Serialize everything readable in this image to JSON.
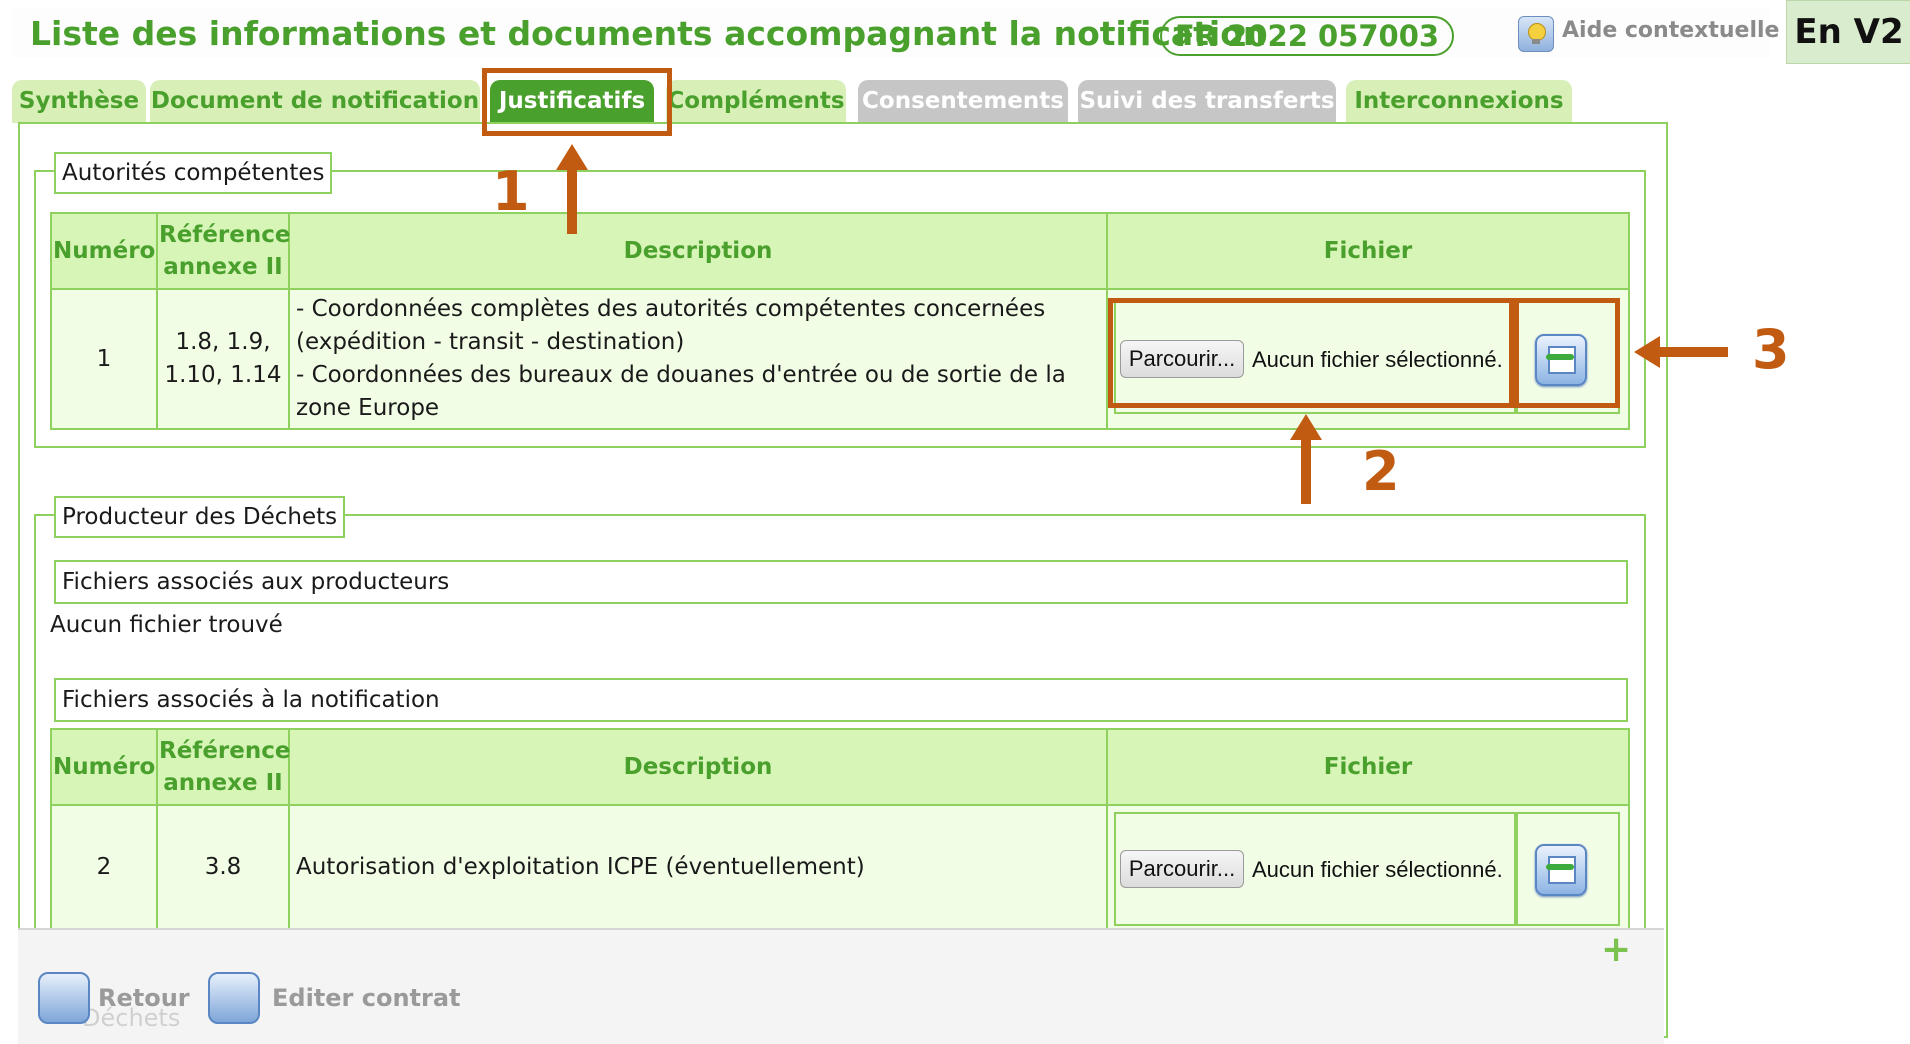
{
  "header": {
    "title": "Liste des informations et documents accompagnant la notification",
    "notification_number": "FR 2022 057003",
    "help_label": "Aide contextuelle",
    "version_tag": "En V2"
  },
  "tabs": [
    {
      "label": "Synthèse",
      "state": "enabled"
    },
    {
      "label": "Document de notification",
      "state": "enabled"
    },
    {
      "label": "Justificatifs",
      "state": "active"
    },
    {
      "label": "Compléments",
      "state": "enabled"
    },
    {
      "label": "Consentements",
      "state": "disabled"
    },
    {
      "label": "Suivi des transferts",
      "state": "disabled"
    },
    {
      "label": "Interconnexions",
      "state": "enabled"
    }
  ],
  "columns": {
    "numero": "Numéro",
    "reference_line1": "Référence",
    "reference_line2": "annexe II",
    "description": "Description",
    "fichier": "Fichier"
  },
  "autorites": {
    "legend": "Autorités compétentes",
    "row": {
      "numero": "1",
      "ref_line1": "1.8, 1.9,",
      "ref_line2": "1.10, 1.14",
      "desc_line1": "- Coordonnées complètes des autorités compétentes concernées",
      "desc_line2": "(expédition - transit - destination)",
      "desc_line3": "- Coordonnées des bureaux de douanes d'entrée ou de sortie de la",
      "desc_line4": "zone Europe",
      "browse_label": "Parcourir...",
      "file_status": "Aucun fichier sélectionné."
    }
  },
  "producteur": {
    "legend": "Producteur des Déchets",
    "producers_files_label": "Fichiers associés aux producteurs",
    "no_file_found": "Aucun fichier trouvé",
    "notification_files_label": "Fichiers associés à la notification",
    "row": {
      "numero": "2",
      "ref": "3.8",
      "description": "Autorisation d'exploitation ICPE (éventuellement)",
      "browse_label": "Parcourir...",
      "file_status": "Aucun fichier sélectionné."
    }
  },
  "footer": {
    "back_label": "Retour",
    "edit_label": "Editer contrat",
    "hidden_text": "Déchets"
  },
  "annotations": [
    "1",
    "2",
    "3"
  ],
  "colors": {
    "brand_green": "#4aa02c",
    "border_green": "#8fd15f",
    "annotation": "#c25b12"
  }
}
